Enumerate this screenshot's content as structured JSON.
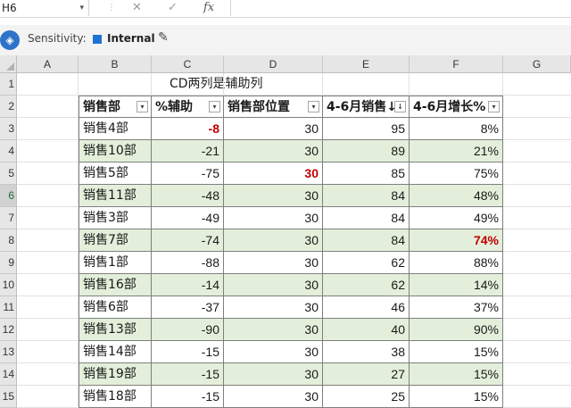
{
  "formula_bar": {
    "name_box": "H6",
    "name_box_chevron": "▾",
    "cancel_icon": "✕",
    "enter_icon": "✓",
    "fx_label": "fx",
    "formula": ""
  },
  "sensitivity": {
    "label": "Sensitivity:",
    "value": "Internal",
    "color": "#1e73d2"
  },
  "columns": [
    "A",
    "B",
    "C",
    "D",
    "E",
    "F",
    "G"
  ],
  "row_numbers": [
    "1",
    "2",
    "3",
    "4",
    "5",
    "6",
    "7",
    "8",
    "9",
    "10",
    "11",
    "12",
    "13",
    "14",
    "15"
  ],
  "selected_row": "6",
  "note": "CD两列是辅助列",
  "table": {
    "headers": [
      "销售部",
      "%辅助",
      "销售部位置",
      "4-6月销售↓",
      "4-6月增长%"
    ],
    "sort_icon": "↓",
    "filter_icon": "▾",
    "rows": [
      [
        "销售4部",
        "-8",
        "30",
        "95",
        "8%"
      ],
      [
        "销售10部",
        "-21",
        "30",
        "89",
        "21%"
      ],
      [
        "销售5部",
        "-75",
        "30",
        "85",
        "75%"
      ],
      [
        "销售11部",
        "-48",
        "30",
        "84",
        "48%"
      ],
      [
        "销售3部",
        "-49",
        "30",
        "84",
        "49%"
      ],
      [
        "销售7部",
        "-74",
        "30",
        "84",
        "74%"
      ],
      [
        "销售1部",
        "-88",
        "30",
        "62",
        "88%"
      ],
      [
        "销售16部",
        "-14",
        "30",
        "62",
        "14%"
      ],
      [
        "销售6部",
        "-37",
        "30",
        "46",
        "37%"
      ],
      [
        "销售13部",
        "-90",
        "30",
        "40",
        "90%"
      ],
      [
        "销售14部",
        "-15",
        "30",
        "38",
        "15%"
      ],
      [
        "销售19部",
        "-15",
        "30",
        "27",
        "15%"
      ],
      [
        "销售18部",
        "-15",
        "30",
        "25",
        "15%"
      ]
    ],
    "highlighted_cells": [
      [
        0,
        1
      ],
      [
        2,
        2
      ],
      [
        5,
        4
      ]
    ],
    "colors": {
      "band": "#e3efda",
      "highlight": "#c00000",
      "border": "#7f7f7f"
    }
  }
}
